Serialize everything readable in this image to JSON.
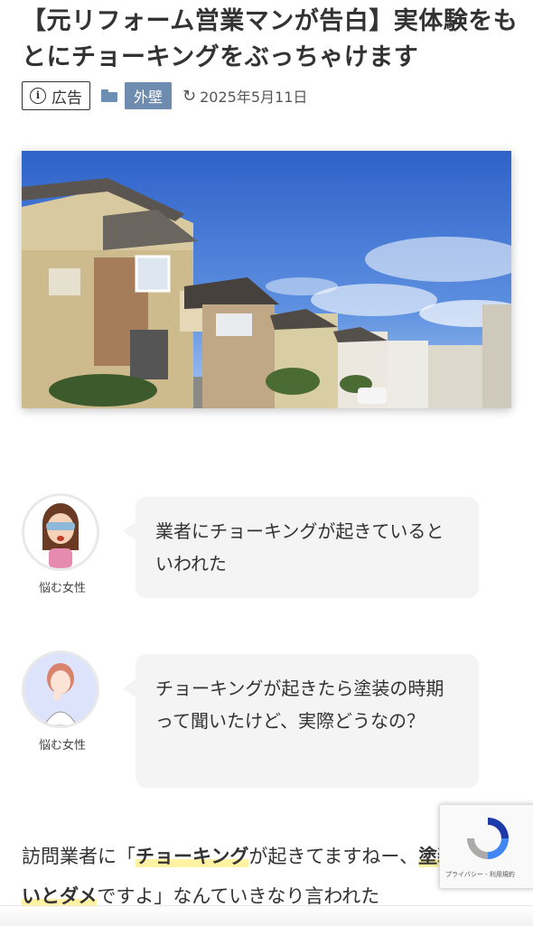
{
  "article": {
    "title": "【元リフォーム営業マンが告白】実体験をもとにチョーキングをぶっちゃけます",
    "ad_label": "広告",
    "category": "外壁",
    "updated_date": "2025年5月11日"
  },
  "icons": {
    "info": "info-icon",
    "folder": "folder-icon",
    "update": "refresh-icon"
  },
  "colors": {
    "category_bg": "#6e8bb0",
    "bubble_bg": "#f4f4f4",
    "highlight": "#fff3a3"
  },
  "speech": [
    {
      "name": "悩む女性",
      "text": "業者にチョーキングが起きているといわれた"
    },
    {
      "name": "悩む女性",
      "text": "チョーキングが起きたら塗装の時期って聞いたけど、実際どうなの？"
    }
  ],
  "body": {
    "p1_before": "訪問業者に「",
    "p1_hl1": "チョーキング",
    "p1_mid": "が起きてますねー、",
    "p1_hl2": "塗装しないとダメ",
    "p1_after": "ですよ」なんていきなり言われた"
  },
  "recaptcha": {
    "links": "プライバシー - 利用規約"
  }
}
